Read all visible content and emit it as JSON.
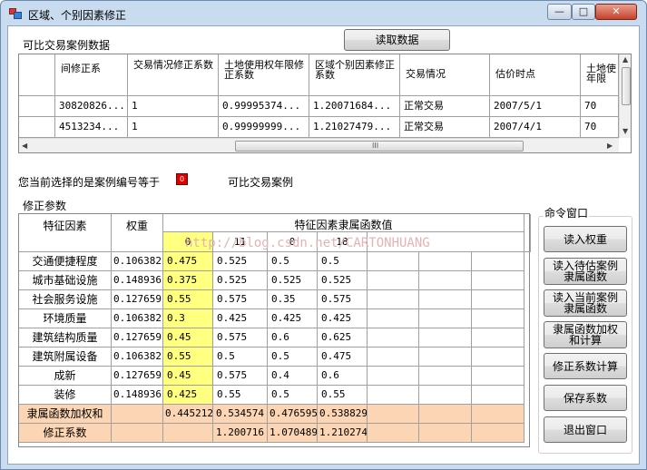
{
  "window": {
    "title": "区域、个别因素修正",
    "min_glyph": "—",
    "max_glyph": "□",
    "close_glyph": "✕"
  },
  "cases_group": {
    "label": "可比交易案例数据",
    "read_button": "读取数据",
    "columns": [
      "间修正系",
      "交易情况修正系数",
      "土地使用权年限修正系数",
      "区域个别因素修正系数",
      "交易情况",
      "估价时点",
      "土地使年限"
    ],
    "rows": [
      [
        "30820826...",
        "1",
        "0.99995374...",
        "1.20071684...",
        "正常交易",
        "2007/5/1",
        "70"
      ],
      [
        "4513234...",
        "1",
        "0.99999999...",
        "1.21027479...",
        "正常交易",
        "2007/4/1",
        "70"
      ]
    ],
    "scroll_grip": "III"
  },
  "selection": {
    "prefix": "您当前选择的是案例编号等于",
    "value": "0",
    "suffix": "可比交易案例"
  },
  "params_group": {
    "label": "修正参数",
    "headers": {
      "factor": "特征因素",
      "weight": "权重",
      "membership": "特征因素隶属函数值"
    },
    "case_numbers": [
      "0",
      "11",
      "0",
      "18"
    ],
    "rows": [
      {
        "factor": "交通便捷程度",
        "weight": "0.106382",
        "values": [
          "0.475",
          "0.525",
          "0.5",
          "0.5"
        ]
      },
      {
        "factor": "城市基础设施",
        "weight": "0.148936",
        "values": [
          "0.375",
          "0.525",
          "0.525",
          "0.525"
        ]
      },
      {
        "factor": "社会服务设施",
        "weight": "0.127659",
        "values": [
          "0.55",
          "0.575",
          "0.35",
          "0.575"
        ]
      },
      {
        "factor": "环境质量",
        "weight": "0.106382",
        "values": [
          "0.3",
          "0.425",
          "0.425",
          "0.425"
        ]
      },
      {
        "factor": "建筑结构质量",
        "weight": "0.127659",
        "values": [
          "0.45",
          "0.575",
          "0.6",
          "0.625"
        ]
      },
      {
        "factor": "建筑附属设备",
        "weight": "0.106382",
        "values": [
          "0.55",
          "0.5",
          "0.5",
          "0.475"
        ]
      },
      {
        "factor": "成新",
        "weight": "0.127659",
        "values": [
          "0.45",
          "0.575",
          "0.4",
          "0.6"
        ]
      },
      {
        "factor": "装修",
        "weight": "0.148936",
        "values": [
          "0.425",
          "0.55",
          "0.5",
          "0.55"
        ]
      }
    ],
    "weighted_sum": {
      "label": "隶属函数加权和",
      "values": [
        "0.445212",
        "0.534574",
        "0.476595",
        "0.538829"
      ]
    },
    "coefficient": {
      "label": "修正系数",
      "values": [
        "1.200716",
        "1.070489",
        "1.210274"
      ]
    }
  },
  "watermark": "http://blog.csdn.net/CARTONHUANG",
  "commands": {
    "label": "命令窗口",
    "buttons": [
      "读入权重",
      "读入待估案例\n隶属函数",
      "读入当前案例\n隶属函数",
      "隶属函数加权\n和计算",
      "修正系数计算",
      "保存系数",
      "退出窗口"
    ]
  },
  "colors": {
    "highlight_yellow": "#ffff80",
    "peach": "#fcd5b4",
    "selection_red": "#e00000",
    "title_bar": "#c9dcef"
  }
}
